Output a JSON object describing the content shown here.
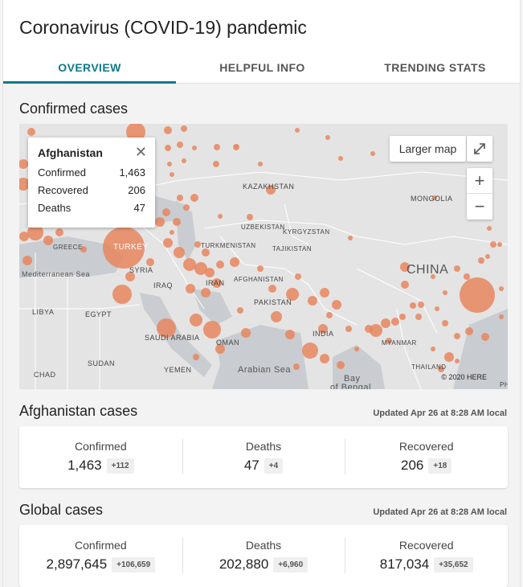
{
  "title": "Coronavirus (COVID-19) pandemic",
  "tabs": [
    {
      "label": "OVERVIEW"
    },
    {
      "label": "HELPFUL INFO"
    },
    {
      "label": "TRENDING STATS"
    }
  ],
  "map_section": {
    "title": "Confirmed cases",
    "larger_map_label": "Larger map",
    "copyright": "© 2020 HERE",
    "labels": {
      "kazakhstan": "KAZAKHSTAN",
      "mongolia": "MONGOLIA",
      "uzbekistan": "UZBEKISTAN",
      "kyrgyzstan": "KYRGYZSTAN",
      "turkmenistan": "TURKMENISTAN",
      "tajikistan": "TAJIKISTAN",
      "turkey": "TURKEY",
      "greece": "GREECE",
      "syria": "SYRIA",
      "iraq": "IRAQ",
      "iran": "IRAN",
      "afghanistan": "AFGHANISTAN",
      "pakistan": "PAKISTAN",
      "china": "CHINA",
      "india": "INDIA",
      "libya": "LIBYA",
      "egypt": "EGYPT",
      "saudi_arabia": "SAUDI ARABIA",
      "oman": "OMAN",
      "yemen": "YEMEN",
      "sudan": "SUDAN",
      "chad": "CHAD",
      "arabian_sea": "Arabian Sea",
      "bay": "Bay",
      "of_bengal": "of Bengal",
      "mediterranean": "Mediterranean Sea",
      "myanmar": "MYANMAR",
      "thailand": "THAILAND",
      "ph": "PH"
    },
    "popup": {
      "country": "Afghanistan",
      "rows": [
        {
          "label": "Confirmed",
          "value": "1,463"
        },
        {
          "label": "Recovered",
          "value": "206"
        },
        {
          "label": "Deaths",
          "value": "47"
        }
      ]
    }
  },
  "country_cases": {
    "title": "Afghanistan cases",
    "updated": "Updated Apr 26 at 8:28 AM local",
    "stats": [
      {
        "label": "Confirmed",
        "value": "1,463",
        "delta": "+112"
      },
      {
        "label": "Deaths",
        "value": "47",
        "delta": "+4"
      },
      {
        "label": "Recovered",
        "value": "206",
        "delta": "+18"
      }
    ]
  },
  "global_cases": {
    "title": "Global cases",
    "updated": "Updated Apr 26 at 8:28 AM local",
    "stats": [
      {
        "label": "Confirmed",
        "value": "2,897,645",
        "delta": "+106,659"
      },
      {
        "label": "Deaths",
        "value": "202,880",
        "delta": "+6,960"
      },
      {
        "label": "Recovered",
        "value": "817,034",
        "delta": "+35,652"
      }
    ]
  },
  "colors": {
    "accent": "#0b7a8a",
    "bubble": "#e8825a"
  }
}
